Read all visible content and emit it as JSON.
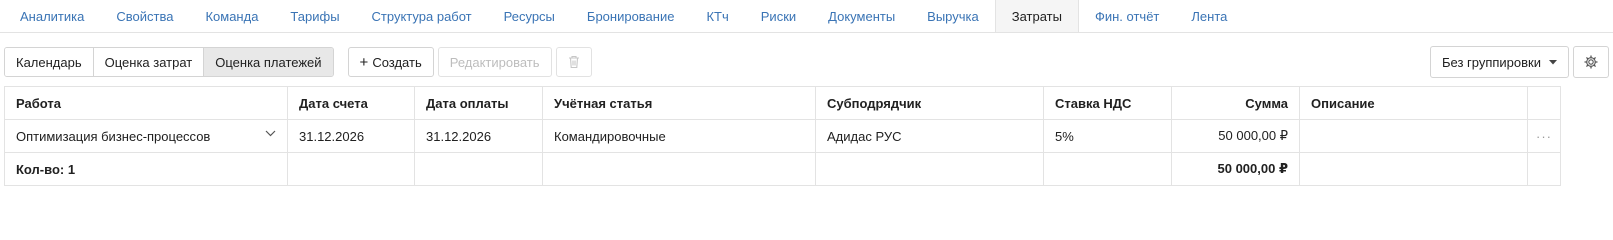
{
  "tabs": [
    {
      "label": "Аналитика"
    },
    {
      "label": "Свойства"
    },
    {
      "label": "Команда"
    },
    {
      "label": "Тарифы"
    },
    {
      "label": "Структура работ"
    },
    {
      "label": "Ресурсы"
    },
    {
      "label": "Бронирование"
    },
    {
      "label": "КТч"
    },
    {
      "label": "Риски"
    },
    {
      "label": "Документы"
    },
    {
      "label": "Выручка"
    },
    {
      "label": "Затраты"
    },
    {
      "label": "Фин. отчёт"
    },
    {
      "label": "Лента"
    }
  ],
  "active_tab": "Затраты",
  "toolbar": {
    "views": [
      {
        "label": "Календарь"
      },
      {
        "label": "Оценка затрат"
      },
      {
        "label": "Оценка платежей"
      }
    ],
    "active_view": "Оценка платежей",
    "create_label": "Создать",
    "create_icon": "plus-icon",
    "edit_label": "Редактировать",
    "delete_icon": "trash-icon",
    "grouping_label": "Без группировки",
    "settings_icon": "gear-icon"
  },
  "table": {
    "columns": [
      "Работа",
      "Дата счета",
      "Дата оплаты",
      "Учётная статья",
      "Субподрядчик",
      "Ставка НДС",
      "Сумма",
      "Описание"
    ],
    "rows": [
      {
        "work": "Оптимизация бизнес-процессов",
        "invoice_date": "31.12.2026",
        "payment_date": "31.12.2026",
        "article": "Командировочные",
        "subcontractor": "Адидас РУС",
        "vat": "5%",
        "amount": "50 000,00 ₽",
        "description": ""
      }
    ],
    "total": {
      "count_label": "Кол-во: 1",
      "amount": "50 000,00 ₽"
    }
  }
}
